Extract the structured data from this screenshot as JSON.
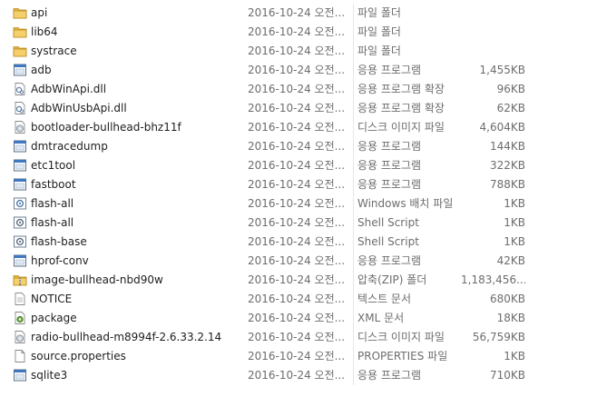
{
  "files": [
    {
      "name": "api",
      "date": "2016-10-24 오전...",
      "type": "파일 폴더",
      "size": "",
      "icon": "folder-icon"
    },
    {
      "name": "lib64",
      "date": "2016-10-24 오전...",
      "type": "파일 폴더",
      "size": "",
      "icon": "folder-icon"
    },
    {
      "name": "systrace",
      "date": "2016-10-24 오전...",
      "type": "파일 폴더",
      "size": "",
      "icon": "folder-icon"
    },
    {
      "name": "adb",
      "date": "2016-10-24 오전...",
      "type": "응용 프로그램",
      "size": "1,455KB",
      "icon": "application-icon"
    },
    {
      "name": "AdbWinApi.dll",
      "date": "2016-10-24 오전...",
      "type": "응용 프로그램 확장",
      "size": "96KB",
      "icon": "dll-file-icon"
    },
    {
      "name": "AdbWinUsbApi.dll",
      "date": "2016-10-24 오전...",
      "type": "응용 프로그램 확장",
      "size": "62KB",
      "icon": "dll-file-icon"
    },
    {
      "name": "bootloader-bullhead-bhz11f",
      "date": "2016-10-24 오전...",
      "type": "디스크 이미지 파일",
      "size": "4,604KB",
      "icon": "disk-image-icon"
    },
    {
      "name": "dmtracedump",
      "date": "2016-10-24 오전...",
      "type": "응용 프로그램",
      "size": "144KB",
      "icon": "application-icon"
    },
    {
      "name": "etc1tool",
      "date": "2016-10-24 오전...",
      "type": "응용 프로그램",
      "size": "322KB",
      "icon": "application-icon"
    },
    {
      "name": "fastboot",
      "date": "2016-10-24 오전...",
      "type": "응용 프로그램",
      "size": "788KB",
      "icon": "application-icon"
    },
    {
      "name": "flash-all",
      "date": "2016-10-24 오전...",
      "type": "Windows 배치 파일",
      "size": "1KB",
      "icon": "batch-file-icon"
    },
    {
      "name": "flash-all",
      "date": "2016-10-24 오전...",
      "type": "Shell Script",
      "size": "1KB",
      "icon": "script-file-icon"
    },
    {
      "name": "flash-base",
      "date": "2016-10-24 오전...",
      "type": "Shell Script",
      "size": "1KB",
      "icon": "script-file-icon"
    },
    {
      "name": "hprof-conv",
      "date": "2016-10-24 오전...",
      "type": "응용 프로그램",
      "size": "42KB",
      "icon": "application-icon"
    },
    {
      "name": "image-bullhead-nbd90w",
      "date": "2016-10-24 오전...",
      "type": "압축(ZIP) 폴더",
      "size": "1,183,456...",
      "icon": "zip-folder-icon"
    },
    {
      "name": "NOTICE",
      "date": "2016-10-24 오전...",
      "type": "텍스트 문서",
      "size": "680KB",
      "icon": "text-file-icon"
    },
    {
      "name": "package",
      "date": "2016-10-24 오전...",
      "type": "XML 문서",
      "size": "18KB",
      "icon": "xml-file-icon"
    },
    {
      "name": "radio-bullhead-m8994f-2.6.33.2.14",
      "date": "2016-10-24 오전...",
      "type": "디스크 이미지 파일",
      "size": "56,759KB",
      "icon": "disk-image-icon"
    },
    {
      "name": "source.properties",
      "date": "2016-10-24 오전...",
      "type": "PROPERTIES 파일",
      "size": "1KB",
      "icon": "blank-file-icon"
    },
    {
      "name": "sqlite3",
      "date": "2016-10-24 오전...",
      "type": "응용 프로그램",
      "size": "710KB",
      "icon": "application-icon"
    }
  ]
}
